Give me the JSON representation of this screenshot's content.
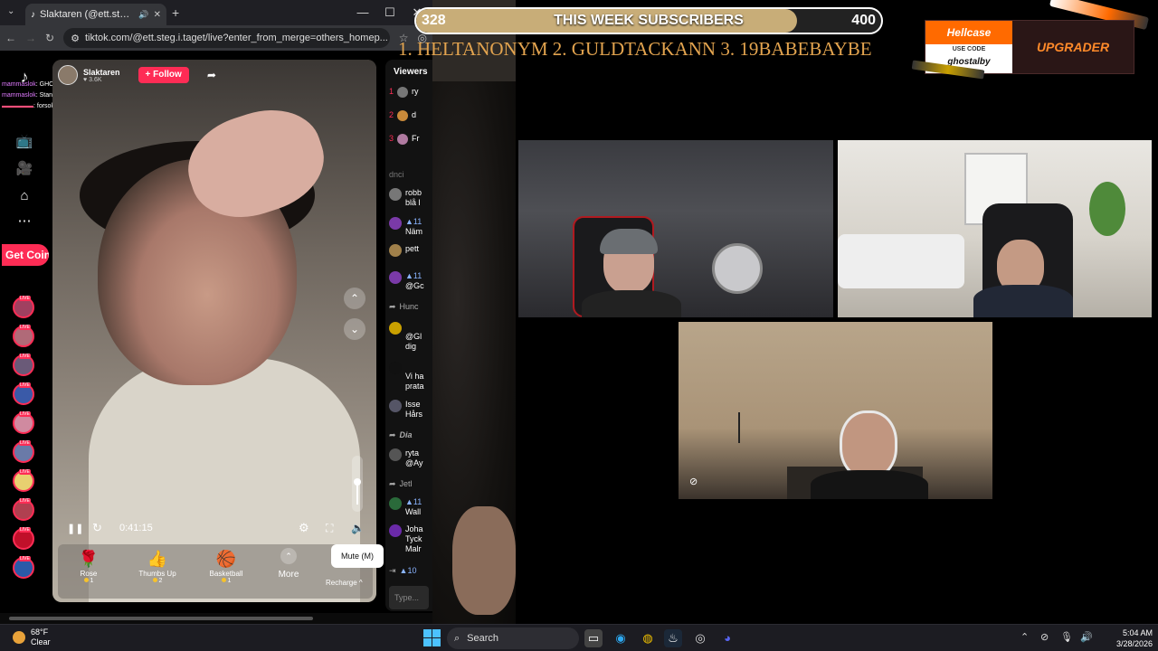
{
  "browser": {
    "tab_title": "Slaktaren (@ett.steg.i.taget)",
    "url": "tiktok.com/@ett.steg.i.taget/live?enter_from_merge=others_homep...",
    "win_minimize": "—",
    "win_maximize": "☐",
    "win_close": "✕",
    "new_tab": "+"
  },
  "tiktok": {
    "get_coins": "Get Coins",
    "chat": [
      {
        "user": "mammaslok",
        "text": "GHOST"
      },
      {
        "user": "mammaslok",
        "text": "Stang ner han!"
      },
      {
        "user": "",
        "text": "forsoker han harma dig elr vad?"
      }
    ],
    "streamer_name": "Slaktaren",
    "streamer_followers": "3.6K",
    "follow_label": "+ Follow",
    "time": "0:41:15",
    "volume_level": 0.55,
    "gifts": [
      {
        "name": "Rose",
        "price": "1",
        "icon": "🌹"
      },
      {
        "name": "Thumbs Up",
        "price": "2",
        "icon": "👍"
      },
      {
        "name": "Basketball",
        "price": "1",
        "icon": "🏀"
      }
    ],
    "more_label": "More",
    "recharge_label": "Recharge ^",
    "tooltip": "Mute (M)",
    "viewers_title": "Viewers",
    "viewers": [
      {
        "rank": "1",
        "name": "ry"
      },
      {
        "rank": "2",
        "name": "d"
      },
      {
        "rank": "3",
        "name": "Fr"
      }
    ],
    "side_chat": [
      {
        "name": "dnci"
      },
      {
        "name": "robb",
        "text": "blå l"
      },
      {
        "name": "Näm"
      },
      {
        "name": "pett",
        "text": "@Gc"
      },
      {
        "name": "@Gc"
      },
      {
        "name": "Hunc"
      },
      {
        "name": "@Gl",
        "text": "dig"
      },
      {
        "name": "Vi ha",
        "text": "prata"
      },
      {
        "name": "Isse",
        "text": "Hårs"
      },
      {
        "name": "Dia"
      },
      {
        "name": "ryta",
        "text": "@Ay"
      },
      {
        "name": "Jetl"
      },
      {
        "name": "Wall"
      },
      {
        "name": "Joha",
        "text": "Tyck"
      },
      {
        "name": "Malr"
      }
    ],
    "type_placeholder": "Type..."
  },
  "overlay": {
    "sub_current": "328",
    "sub_title": "THIS WEEK SUBSCRIBERS",
    "sub_goal": "400",
    "sub_progress": 0.82,
    "top_list": "1. HELTANONYM  2. GULDTACKANN  3. 19BABEBAYBE",
    "hellcase_brand": "Hellcase",
    "hellcase_use_code": "USE CODE",
    "hellcase_code": "ghostalby",
    "hellcase_upgrader": "UPGRADER"
  },
  "taskbar": {
    "temp": "68°F",
    "condition": "Clear",
    "search_label": "Search",
    "time": "5:04 AM",
    "date": "3/28/2026"
  }
}
